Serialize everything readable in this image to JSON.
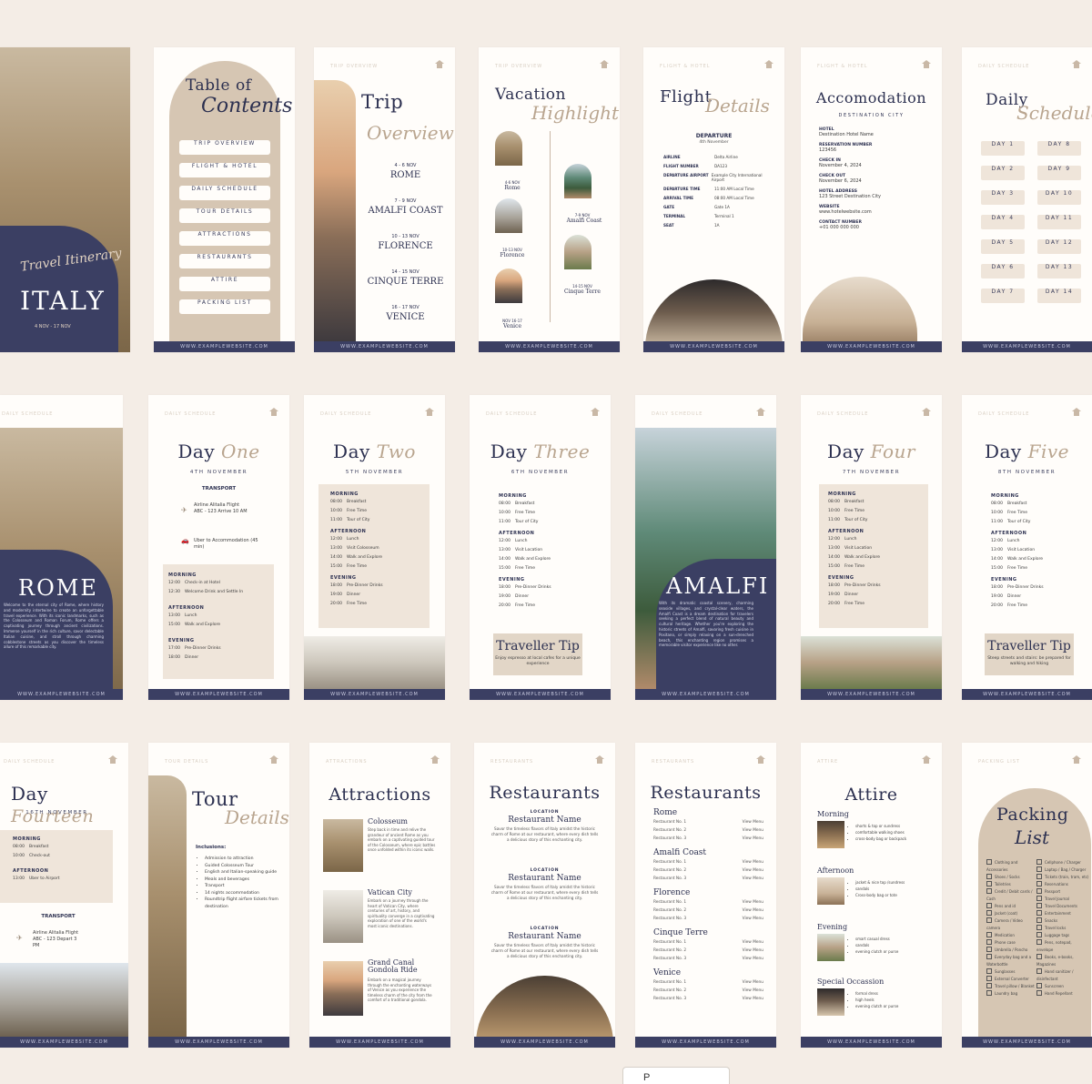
{
  "footer_url": "WWW.EXAMPLEWEBSITE.COM",
  "row1": {
    "cover": {
      "script": "Travel Itinerary",
      "title": "ITALY",
      "dates": "4 NOV - 17 NOV"
    },
    "toc": {
      "title": "Table of",
      "script": "Contents",
      "items": [
        "TRIP OVERVIEW",
        "FLIGHT & HOTEL",
        "DAILY SCHEDULE",
        "TOUR DETAILS",
        "ATTRACTIONS",
        "RESTAURANTS",
        "ATTIRE",
        "PACKING LIST"
      ]
    },
    "overview": {
      "tag": "TRIP OVERVIEW",
      "title": "Trip",
      "script": "Overview",
      "stops": [
        {
          "dates": "4 - 6 NOV",
          "city": "ROME"
        },
        {
          "dates": "7 - 9 NOV",
          "city": "AMALFI COAST"
        },
        {
          "dates": "10 - 13 NOV",
          "city": "FLORENCE"
        },
        {
          "dates": "14 - 15 NOV",
          "city": "CINQUE TERRE"
        },
        {
          "dates": "16 - 17 NOV",
          "city": "VENICE"
        }
      ]
    },
    "highlight": {
      "tag": "TRIP OVERVIEW",
      "title": "Vacation",
      "script": "Highlight",
      "items": [
        {
          "dates": "4-6 NOV",
          "city": "Rome"
        },
        {
          "dates": "7-9 NOV",
          "city": "Amalfi Coast"
        },
        {
          "dates": "10-13 NOV",
          "city": "Florence"
        },
        {
          "dates": "14-15 NOV",
          "city": "Cinque Terre"
        },
        {
          "dates": "NOV 16-17",
          "city": "Venice"
        }
      ]
    },
    "flight": {
      "tag": "FLIGHT & HOTEL",
      "title": "Flight",
      "script": "Details",
      "departure": "DEPARTURE",
      "date": "4th November",
      "rows": [
        {
          "k": "AIRLINE",
          "v": "Delta Airline"
        },
        {
          "k": "FLIGHT NUMBER",
          "v": "DA123"
        },
        {
          "k": "DEPARTURE AIRPORT",
          "v": "Example City International Airport"
        },
        {
          "k": "DEPARTURE TIME",
          "v": "11:00 AM Local Time"
        },
        {
          "k": "ARRIVAL TIME",
          "v": "08:00 AM Local Time"
        },
        {
          "k": "GATE",
          "v": "Gate 1A"
        },
        {
          "k": "TERMINAL",
          "v": "Terminal 1"
        },
        {
          "k": "SEAT",
          "v": "1A"
        }
      ]
    },
    "hotel": {
      "tag": "FLIGHT & HOTEL",
      "title": "Accomodation",
      "sub": "DESTINATION CITY",
      "rows": [
        {
          "k": "HOTEL",
          "v": "Destination Hotel Name"
        },
        {
          "k": "RESERVATION NUMBER",
          "v": "123456"
        },
        {
          "k": "CHECK IN",
          "v": "November 4, 2024"
        },
        {
          "k": "CHECK OUT",
          "v": "November 6, 2024"
        },
        {
          "k": "HOTEL ADDRESS",
          "v": "123 Street Destination City"
        },
        {
          "k": "WEBSITE",
          "v": "www.hotelwebsite.com"
        },
        {
          "k": "CONTACT NUMBER",
          "v": "+01 000 000 000"
        }
      ]
    },
    "daily": {
      "tag": "DAILY SCHEDULE",
      "title": "Daily",
      "script": "Schedule",
      "days": [
        "DAY 1",
        "DAY 8",
        "DAY 2",
        "DAY 9",
        "DAY 3",
        "DAY 10",
        "DAY 4",
        "DAY 11",
        "DAY 5",
        "DAY 12",
        "DAY 6",
        "DAY 13",
        "DAY 7",
        "DAY 14"
      ]
    }
  },
  "row2": {
    "rome": {
      "tag": "DAILY SCHEDULE",
      "city": "ROME",
      "text": "Welcome to the eternal city of Rome, where history and modernity intertwine to create an unforgettable travel experience. With its iconic landmarks, such as the Colosseum and Roman Forum, Rome offers a captivating journey through ancient civilizations. Immerse yourself in the rich culture, savor delectable Italian cuisine, and stroll through charming cobblestone streets as you discover the timeless allure of this remarkable city."
    },
    "day1": {
      "tag": "DAILY SCHEDULE",
      "title": "Day",
      "script": "One",
      "date": "4TH NOVEMBER",
      "transport": "TRANSPORT",
      "t1": "Airline Alitalia Flight ABC - 123 Arrive 10 AM",
      "t2": "Uber to Accommodation (45 min)",
      "morning": "MORNING",
      "m": [
        [
          "12:00",
          "Check-in at Hotel"
        ],
        [
          "12:30",
          "Welcome Drink and Settle In"
        ]
      ],
      "afternoon": "AFTERNOON",
      "a": [
        [
          "13:00",
          "Lunch"
        ],
        [
          "15:00",
          "Walk and Explore"
        ]
      ],
      "evening": "EVENING",
      "e": [
        [
          "17:00",
          "Pre-Dinner Drinks"
        ],
        [
          "18:00",
          "Dinner"
        ]
      ]
    },
    "day2": {
      "tag": "DAILY SCHEDULE",
      "title": "Day",
      "script": "Two",
      "date": "5TH NOVEMBER",
      "morning": "MORNING",
      "m": [
        [
          "08:00",
          "Breakfast"
        ],
        [
          "10:00",
          "Free Time"
        ],
        [
          "11:00",
          "Tour of City"
        ]
      ],
      "afternoon": "AFTERNOON",
      "a": [
        [
          "12:00",
          "Lunch"
        ],
        [
          "13:00",
          "Visit Colosseum"
        ],
        [
          "14:00",
          "Walk and Explore"
        ],
        [
          "15:00",
          "Free Time"
        ]
      ],
      "evening": "EVENING",
      "e": [
        [
          "18:00",
          "Pre-Dinner Drinks"
        ],
        [
          "19:00",
          "Dinner"
        ],
        [
          "20:00",
          "Free Time"
        ]
      ]
    },
    "day3": {
      "tag": "DAILY SCHEDULE",
      "title": "Day",
      "script": "Three",
      "date": "6TH NOVEMBER",
      "morning": "MORNING",
      "m": [
        [
          "08:00",
          "Breakfast"
        ],
        [
          "10:00",
          "Free Time"
        ],
        [
          "11:00",
          "Tour of City"
        ]
      ],
      "afternoon": "AFTERNOON",
      "a": [
        [
          "12:00",
          "Lunch"
        ],
        [
          "13:00",
          "Visit Location"
        ],
        [
          "14:00",
          "Walk and Explore"
        ],
        [
          "15:00",
          "Free Time"
        ]
      ],
      "evening": "EVENING",
      "e": [
        [
          "18:00",
          "Pre-Dinner Drinks"
        ],
        [
          "19:00",
          "Dinner"
        ],
        [
          "20:00",
          "Free Time"
        ]
      ],
      "tip": "Traveller Tip",
      "tip_text": "Enjoy espresso at local cafes for a unique experience"
    },
    "amalfi": {
      "tag": "DAILY SCHEDULE",
      "city": "AMALFI",
      "text": "With its dramatic coastal scenery, charming seaside villages, and crystal-clear waters, the Amalfi Coast is a dream destination for travelers seeking a perfect blend of natural beauty and cultural heritage. Whether you're exploring the historic streets of Amalfi, savoring fresh cuisine in Positano, or simply relaxing on a sun-drenched beach, this enchanting region promises a memorable visitor experience like no other."
    },
    "day4": {
      "tag": "DAILY SCHEDULE",
      "title": "Day",
      "script": "Four",
      "date": "7TH NOVEMBER",
      "morning": "MORNING",
      "m": [
        [
          "08:00",
          "Breakfast"
        ],
        [
          "10:00",
          "Free Time"
        ],
        [
          "11:00",
          "Tour of City"
        ]
      ],
      "afternoon": "AFTERNOON",
      "a": [
        [
          "12:00",
          "Lunch"
        ],
        [
          "13:00",
          "Visit Location"
        ],
        [
          "14:00",
          "Walk and Explore"
        ],
        [
          "15:00",
          "Free Time"
        ]
      ],
      "evening": "EVENING",
      "e": [
        [
          "18:00",
          "Pre-Dinner Drinks"
        ],
        [
          "19:00",
          "Dinner"
        ],
        [
          "20:00",
          "Free Time"
        ]
      ]
    },
    "day5": {
      "tag": "DAILY SCHEDULE",
      "title": "Day",
      "script": "Five",
      "date": "8TH NOVEMBER",
      "morning": "MORNING",
      "m": [
        [
          "08:00",
          "Breakfast"
        ],
        [
          "10:00",
          "Free Time"
        ],
        [
          "11:00",
          "Tour of City"
        ]
      ],
      "afternoon": "AFTERNOON",
      "a": [
        [
          "12:00",
          "Lunch"
        ],
        [
          "13:00",
          "Visit Location"
        ],
        [
          "14:00",
          "Walk and Explore"
        ],
        [
          "15:00",
          "Free Time"
        ]
      ],
      "evening": "EVENING",
      "e": [
        [
          "18:00",
          "Pre-Dinner Drinks"
        ],
        [
          "19:00",
          "Dinner"
        ],
        [
          "20:00",
          "Free Time"
        ]
      ],
      "tip": "Traveller Tip",
      "tip_text": "Steep streets and stairs: be prepared for walking and hiking"
    }
  },
  "row3": {
    "day14": {
      "tag": "DAILY SCHEDULE",
      "title": "Day",
      "script": "Fourteen",
      "date": "16TH NOVEMBER",
      "morning": "MORNING",
      "m": [
        [
          "08:00",
          "Breakfast"
        ],
        [
          "10:00",
          "Check-out"
        ]
      ],
      "afternoon": "AFTERNOON",
      "a": [
        [
          "13:00",
          "Uber to Airport"
        ]
      ],
      "transport": "TRANSPORT",
      "t1": "Airline Alitalia Flight ABC - 123 Depart 3 PM"
    },
    "tour": {
      "tag": "TOUR DETAILS",
      "title": "Tour",
      "script": "Details",
      "incl": "Inclusions:",
      "items": [
        "Admission to attraction",
        "Guided Colosseum Tour",
        "English and Italian-speaking guide",
        "Meals and beverages",
        "Transport",
        "14 nights accommodation",
        "Roundtrip flight airfare tickets from destination"
      ]
    },
    "attractions": {
      "tag": "ATTRACTIONS",
      "title": "Attractions",
      "items": [
        {
          "name": "Colosseum",
          "text": "Step back in time and relive the grandeur of ancient Rome as you embark on a captivating guided tour of the Colosseum, where epic battles once unfolded within its iconic walls."
        },
        {
          "name": "Vatican City",
          "text": "Embark on a journey through the heart of Vatican City, where centuries of art, history, and spirituality converge in a captivating exploration of one of the world's most iconic destinations."
        },
        {
          "name": "Grand Canal Gondola Ride",
          "text": "Embark on a magical journey through the enchanting waterways of Venice as you experience the timeless charm of the city from the comfort of a traditional gondola."
        }
      ]
    },
    "rest1": {
      "tag": "RESTAURANTS",
      "title": "Restaurants",
      "loc": "LOCATION",
      "name": "Restaurant Name",
      "text": "Savor the timeless flavors of Italy amidst the historic charm of Rome at our restaurant, where every dish tells a delicious story of this enchanting city."
    },
    "rest2": {
      "tag": "RESTAURANTS",
      "title": "Restaurants",
      "cities": [
        "Rome",
        "Amalfi Coast",
        "Florence",
        "Cinque Terre",
        "Venice"
      ],
      "items": [
        "Restaurant No. 1",
        "Restaurant No. 2",
        "Restaurant No. 3"
      ],
      "link": "View Menu"
    },
    "attire": {
      "tag": "ATTIRE",
      "title": "Attire",
      "sections": [
        {
          "name": "Morning",
          "items": [
            "shorts & top or sundress",
            "comfortable walking shoes",
            "cross-body bag or backpack"
          ]
        },
        {
          "name": "Afternoon",
          "items": [
            "jacket & nice top /sundress",
            "sandals",
            "Cross-body bag or tote"
          ]
        },
        {
          "name": "Evening",
          "items": [
            "smart casual dress",
            "sandals",
            "evening clutch or purse"
          ]
        },
        {
          "name": "Special Occassion",
          "items": [
            "formal dress",
            "high heels",
            "evening clutch or purse"
          ]
        }
      ]
    },
    "packing": {
      "tag": "PACKING LIST",
      "title": "Packing",
      "script": "List",
      "col1": [
        "Clothing and Accessories",
        "Shoes / Socks",
        "Toiletries",
        "Credit / Debit cards / Cash",
        "Pens and id",
        "Jacket (coat)",
        "Camera / Video camera",
        "Medication",
        "Phone case",
        "Umbrella / Poncho",
        "Everyday bag and a Waterbottle",
        "Sunglasses",
        "External Converter",
        "Travel pillow / Blanket",
        "Laundry bag"
      ],
      "col2": [
        "Cellphone / Charger",
        "Laptop / Bag / Charger",
        "Tickets (train, tram, etc)",
        "Reservations",
        "Passport",
        "Travel Journal",
        "Travel Documents",
        "Entertainment",
        "Snacks",
        "Travel locks",
        "Luggage tags",
        "Pens, notepad, envelope",
        "Books, e-books, Magazines",
        "Hand sanitizer / disinfectant",
        "Sunscreen",
        "Hand Repellant"
      ]
    }
  },
  "preview": "P"
}
